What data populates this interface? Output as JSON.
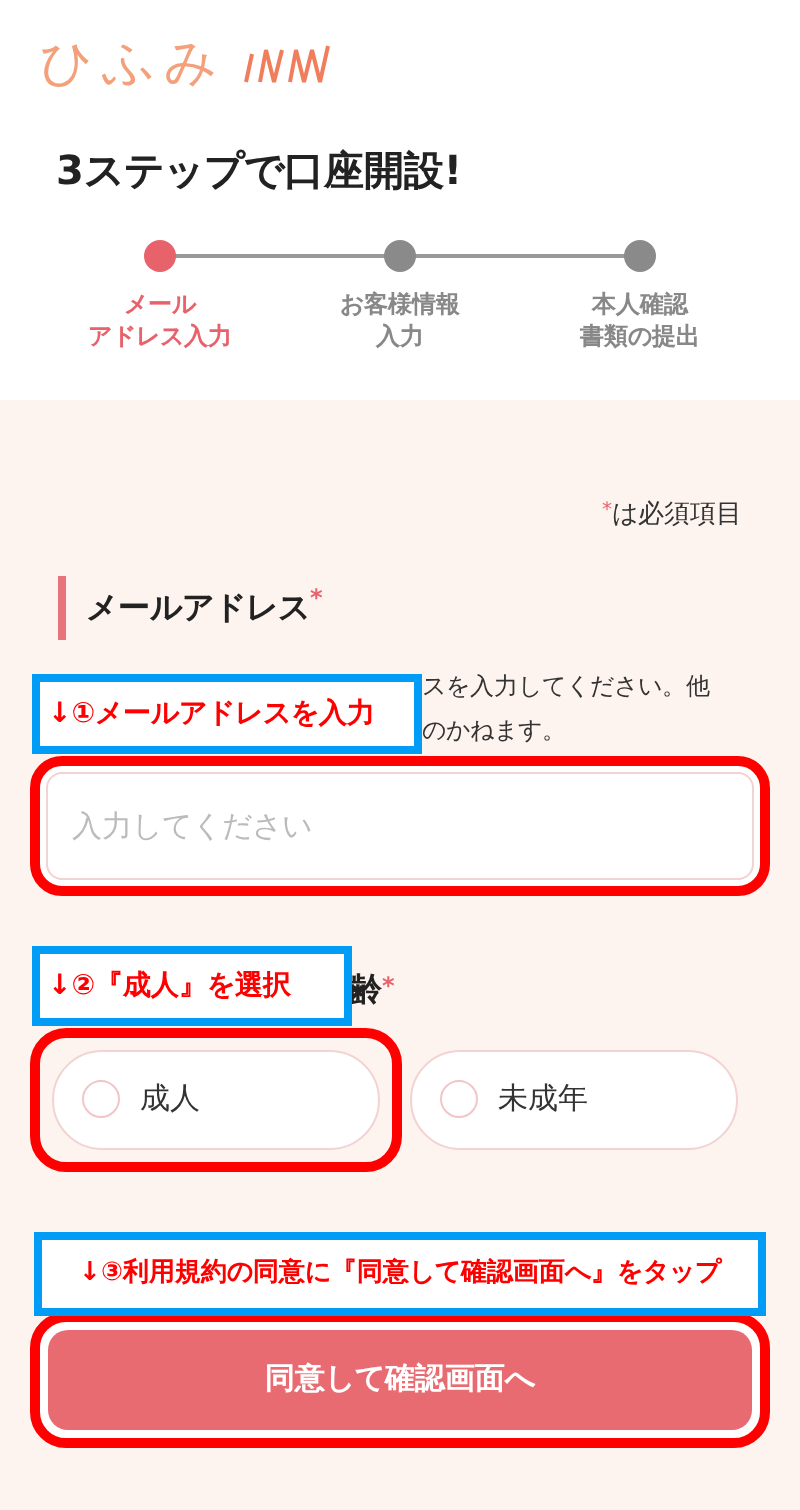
{
  "logo": {
    "text": "ひふみ"
  },
  "title": "3ステップで口座開設!",
  "steps": [
    {
      "label_lines": [
        "メール",
        "アドレス入力"
      ],
      "active": true
    },
    {
      "label_lines": [
        "お客様情報",
        "入力"
      ],
      "active": false
    },
    {
      "label_lines": [
        "本人確認",
        "書類の提出"
      ],
      "active": false
    }
  ],
  "required_note": {
    "mark": "*",
    "text": "は必須項目"
  },
  "email_section": {
    "heading": "メールアドレス",
    "required": "*",
    "description_lines": [
      "スを入力してください。他",
      "のかねます。"
    ],
    "placeholder": "入力してください"
  },
  "age_section": {
    "heading": "齢",
    "required": "*",
    "options": [
      {
        "label": "成人",
        "selected": false
      },
      {
        "label": "未成年",
        "selected": false
      }
    ]
  },
  "submit_button": "同意して確認画面へ",
  "callouts": [
    "↓①メールアドレスを入力",
    "↓②『成人』を選択",
    "↓③利用規約の同意に『同意して確認画面へ』をタップ"
  ]
}
